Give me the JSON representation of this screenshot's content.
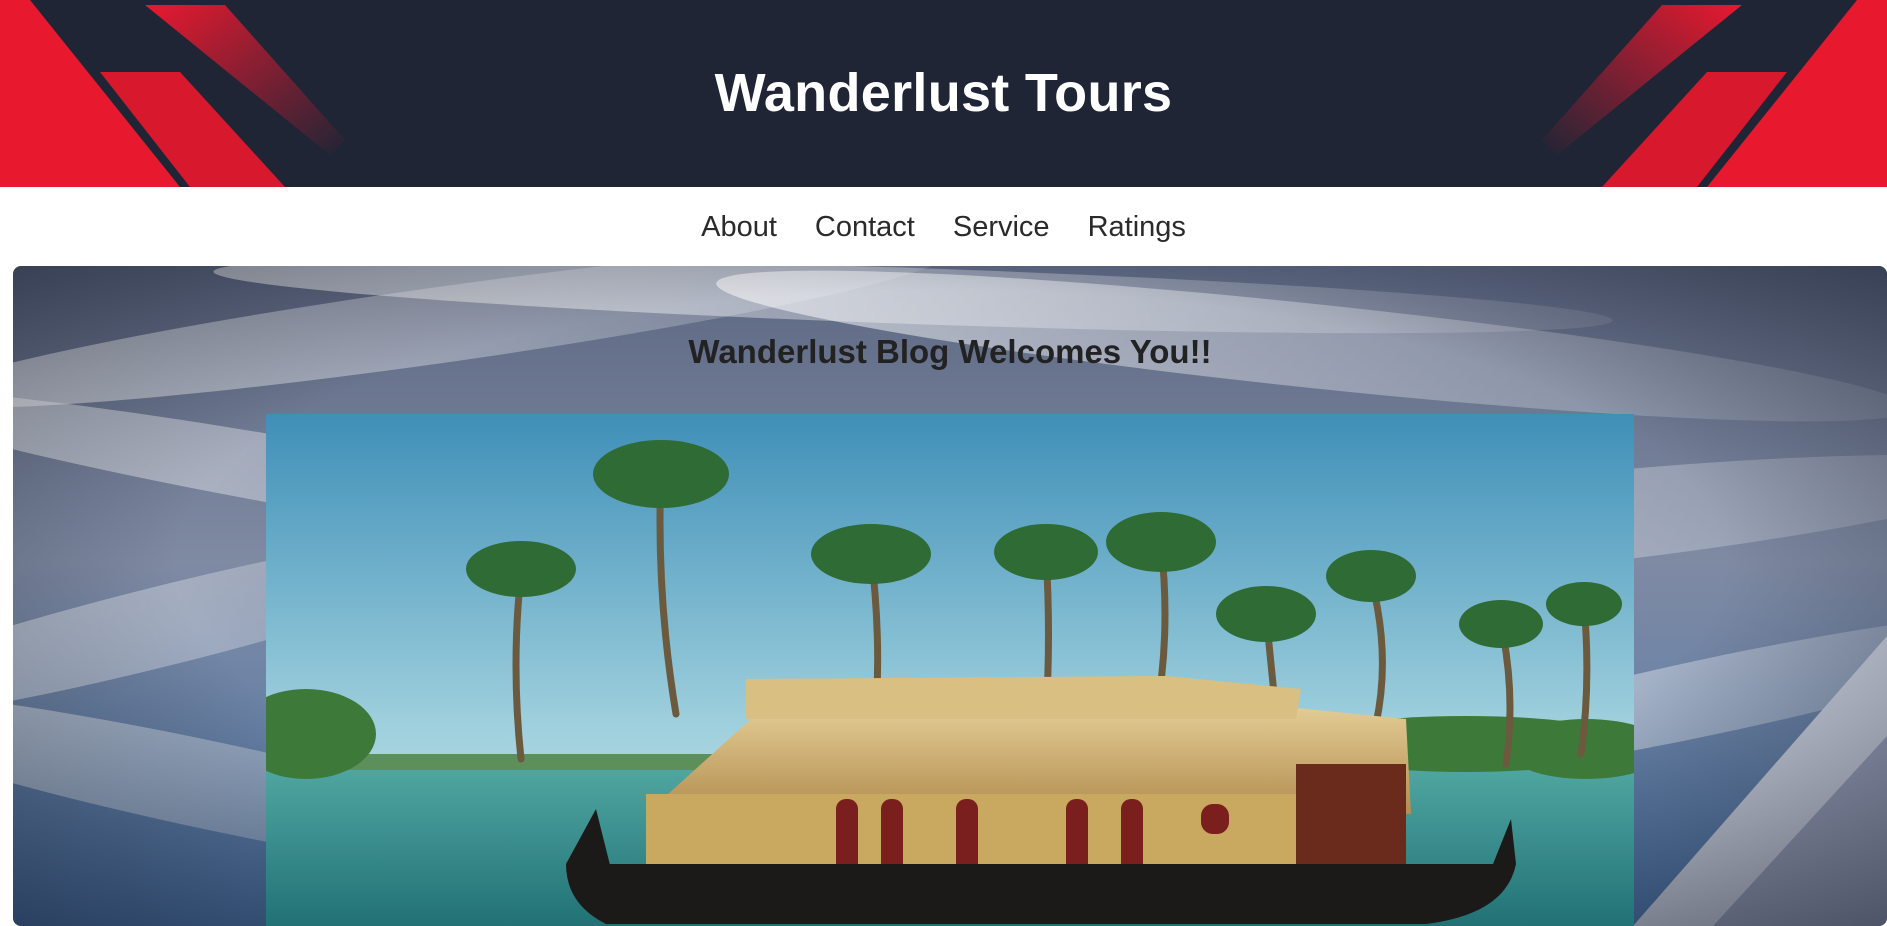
{
  "header": {
    "title": "Wanderlust Tours",
    "accent_color": "#e8192f",
    "background_color": "#1f2535"
  },
  "nav": {
    "items": [
      {
        "label": "About"
      },
      {
        "label": "Contact"
      },
      {
        "label": "Service"
      },
      {
        "label": "Ratings"
      }
    ]
  },
  "hero": {
    "heading": "Wanderlust Blog Welcomes You!!",
    "background_image": "cloudy-sky-mountain",
    "photo": "kerala-houseboat-palms"
  }
}
